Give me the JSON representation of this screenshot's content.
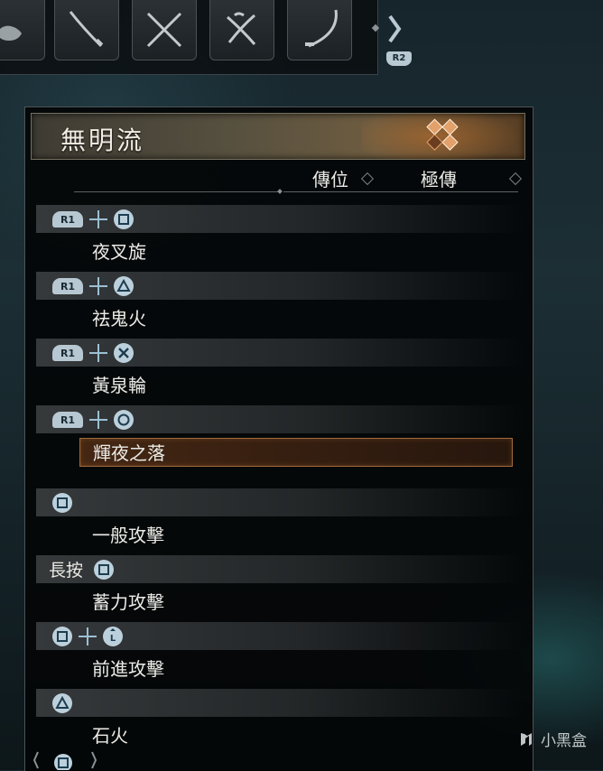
{
  "navigation": {
    "weapon_slots": [
      "fist",
      "katana",
      "dual-katana",
      "switch-blade",
      "odachi"
    ],
    "next_page_button": "R2"
  },
  "panel": {
    "title": "無明流",
    "columns": [
      "傳位",
      "極傳"
    ]
  },
  "skills": [
    {
      "group": "r1",
      "input": [
        "R1",
        "+",
        "square"
      ],
      "name": "夜叉旋",
      "selected": false
    },
    {
      "group": "r1",
      "input": [
        "R1",
        "+",
        "triangle"
      ],
      "name": "祛鬼火",
      "selected": false
    },
    {
      "group": "r1",
      "input": [
        "R1",
        "+",
        "cross"
      ],
      "name": "黃泉輪",
      "selected": false
    },
    {
      "group": "r1",
      "input": [
        "R1",
        "+",
        "circle"
      ],
      "name": "輝夜之落",
      "selected": true
    },
    {
      "group": "basic",
      "input": [
        "square"
      ],
      "name": "一般攻擊",
      "selected": false
    },
    {
      "group": "basic",
      "input": [
        "長按",
        "square"
      ],
      "hold_label": "長按",
      "name": "蓄力攻擊",
      "selected": false
    },
    {
      "group": "basic",
      "input": [
        "square",
        "+",
        "L-stick"
      ],
      "name": "前進攻擊",
      "selected": false
    },
    {
      "group": "basic",
      "input": [
        "triangle"
      ],
      "name": "石火",
      "selected": false
    }
  ],
  "watermark": "小黑盒",
  "colors": {
    "selected_border": "#a06a3e",
    "button_fill": "#bcd0dc",
    "plus_color": "#9cc0d3"
  }
}
